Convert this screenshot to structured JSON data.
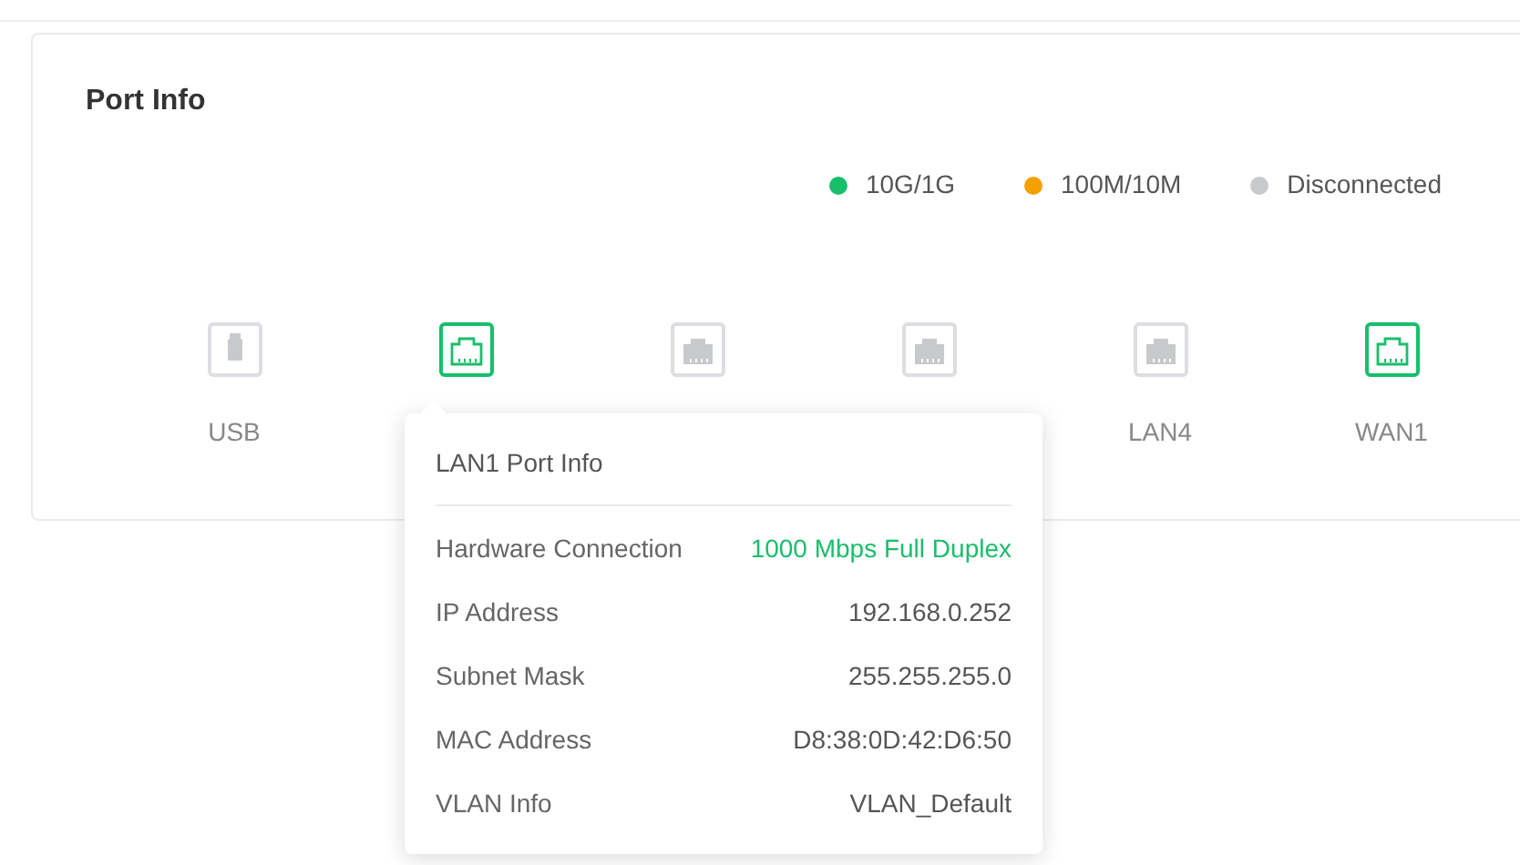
{
  "card": {
    "title": "Port Info"
  },
  "legend": [
    {
      "label": "10G/1G",
      "color": "#19be6b"
    },
    {
      "label": "100M/10M",
      "color": "#f5a000"
    },
    {
      "label": "Disconnected",
      "color": "#c8c9cc"
    }
  ],
  "ports": [
    {
      "kind": "usb",
      "label": "USB",
      "color": "#c8c9cc"
    },
    {
      "kind": "ethernet",
      "color": "#19be6b"
    },
    {
      "kind": "ethernet",
      "color": "#c8c9cc"
    },
    {
      "kind": "ethernet",
      "color": "#c8c9cc"
    },
    {
      "kind": "ethernet",
      "label": "LAN4",
      "color": "#c8c9cc"
    },
    {
      "kind": "ethernet",
      "label": "WAN1",
      "color": "#19be6b"
    }
  ],
  "tooltip": {
    "title": "LAN1 Port Info",
    "rows": [
      {
        "label": "Hardware Connection",
        "value": "1000 Mbps Full Duplex",
        "highlighted": true
      },
      {
        "label": "IP Address",
        "value": "192.168.0.252",
        "highlighted": false
      },
      {
        "label": "Subnet Mask",
        "value": "255.255.255.0",
        "highlighted": false
      },
      {
        "label": "MAC Address",
        "value": "D8:38:0D:42:D6:50",
        "highlighted": false
      },
      {
        "label": "VLAN Info",
        "value": "VLAN_Default",
        "highlighted": false
      }
    ]
  }
}
